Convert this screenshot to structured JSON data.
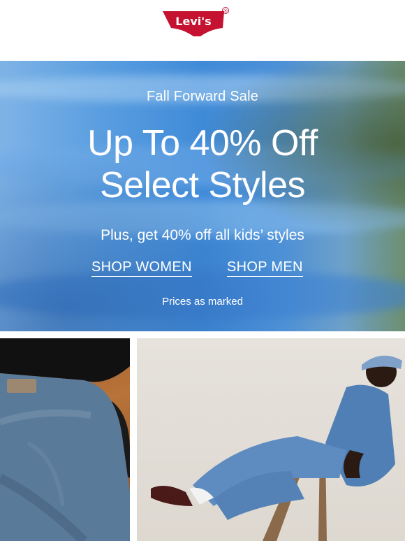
{
  "brand": {
    "logo_text": "Levi's",
    "registered_mark": "®"
  },
  "colors": {
    "brand_red": "#c41230",
    "hero_blue": "#4a92dc",
    "text_on_hero": "#ffffff"
  },
  "hero": {
    "sale_name": "Fall Forward Sale",
    "headline_line1": "Up To 40% Off",
    "headline_line2": "Select Styles",
    "subline": "Plus, get 40% off all kids’ styles",
    "cta_women": "SHOP WOMEN",
    "cta_men": "SHOP MEN",
    "disclaimer": "Prices as marked"
  }
}
